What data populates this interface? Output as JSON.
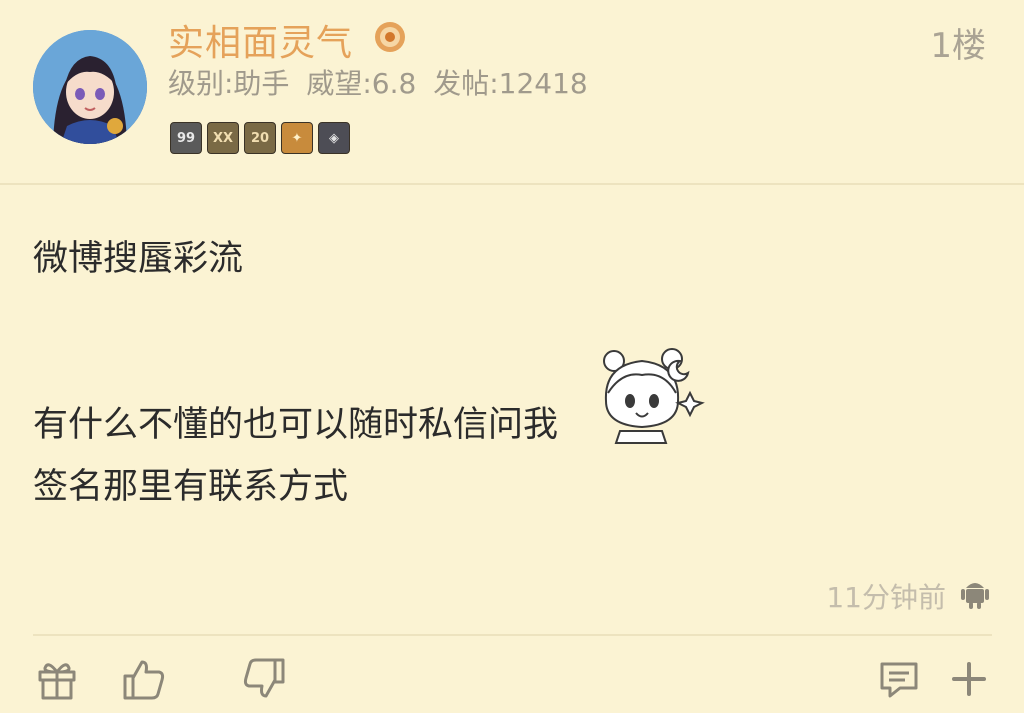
{
  "post": {
    "author": {
      "name": "实相面灵气",
      "level_label": "级别:助手",
      "prestige_label": "威望:6.8",
      "posts_label": "发帖:12418"
    },
    "floor": "1楼",
    "badges": [
      {
        "label": "99"
      },
      {
        "label": "XX"
      },
      {
        "label": "20"
      },
      {
        "label": "✦"
      },
      {
        "label": "◈"
      }
    ],
    "content": {
      "line1": "微博搜蜃彩流",
      "line2": "有什么不懂的也可以随时私信问我",
      "line3": "签名那里有联系方式"
    },
    "time": "11分钟前",
    "actions": {
      "gift": "gift-icon",
      "like": "thumbs-up-icon",
      "dislike": "thumbs-down-icon",
      "comment": "comment-icon",
      "more": "plus-icon"
    }
  },
  "colors": {
    "background": "#fbf3d3",
    "username": "#e5a25a",
    "meta": "#a09a8c",
    "content": "#2b2b2b",
    "icon": "#8c8779"
  }
}
